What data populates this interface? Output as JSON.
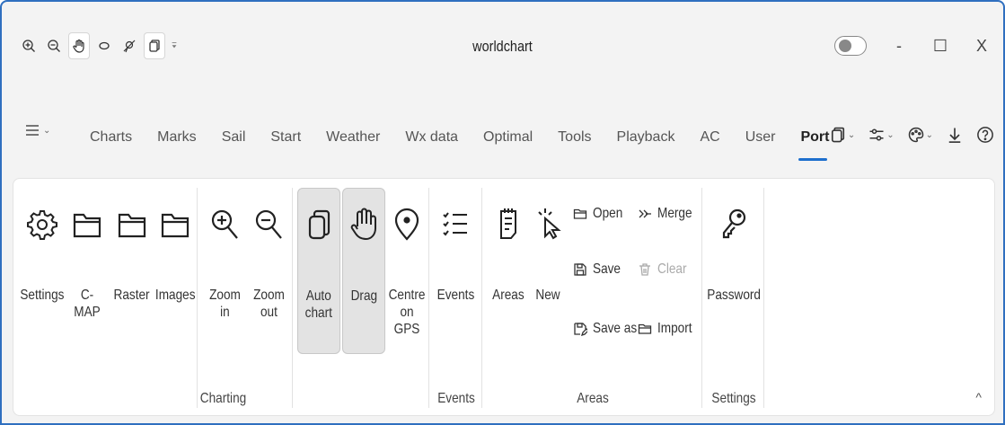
{
  "window": {
    "title": "worldchart"
  },
  "quick_access": {
    "icons": [
      "zoom-in-icon",
      "zoom-out-icon",
      "hand-drag-icon",
      "lasso-icon",
      "no-pin-icon",
      "auto-chart-icon",
      "more-icon"
    ]
  },
  "window_controls": {
    "minimize": "-",
    "maximize": "☐",
    "close": "X"
  },
  "tabs": [
    {
      "label": "Charts"
    },
    {
      "label": "Marks"
    },
    {
      "label": "Sail"
    },
    {
      "label": "Start"
    },
    {
      "label": "Weather"
    },
    {
      "label": "Wx data"
    },
    {
      "label": "Optimal"
    },
    {
      "label": "Tools"
    },
    {
      "label": "Playback"
    },
    {
      "label": "AC"
    },
    {
      "label": "User"
    },
    {
      "label": "Port"
    }
  ],
  "selected_tab": "Port",
  "ribbon": {
    "groups": {
      "charting": {
        "label": "Charting",
        "buttons": {
          "settings": "Settings",
          "cmap": "C-MAP",
          "raster": "Raster",
          "images": "Images",
          "zoom_in": "Zoom\nin",
          "zoom_out": "Zoom\nout",
          "auto_chart": "Auto\nchart",
          "drag": "Drag",
          "centre_gps": "Centre\non GPS"
        }
      },
      "events": {
        "label": "Events",
        "buttons": {
          "events": "Events"
        }
      },
      "areas": {
        "label": "Areas",
        "buttons": {
          "areas": "Areas",
          "new": "New",
          "open": "Open",
          "merge": "Merge",
          "save": "Save",
          "clear": "Clear",
          "save_as": "Save as",
          "import": "Import"
        }
      },
      "settings": {
        "label": "Settings",
        "buttons": {
          "password": "Password"
        }
      }
    },
    "collapse_glyph": "^"
  },
  "colors": {
    "accent": "#1d6fcd",
    "window_border": "#2f6fbf",
    "pressed_bg": "#e3e3e3"
  }
}
